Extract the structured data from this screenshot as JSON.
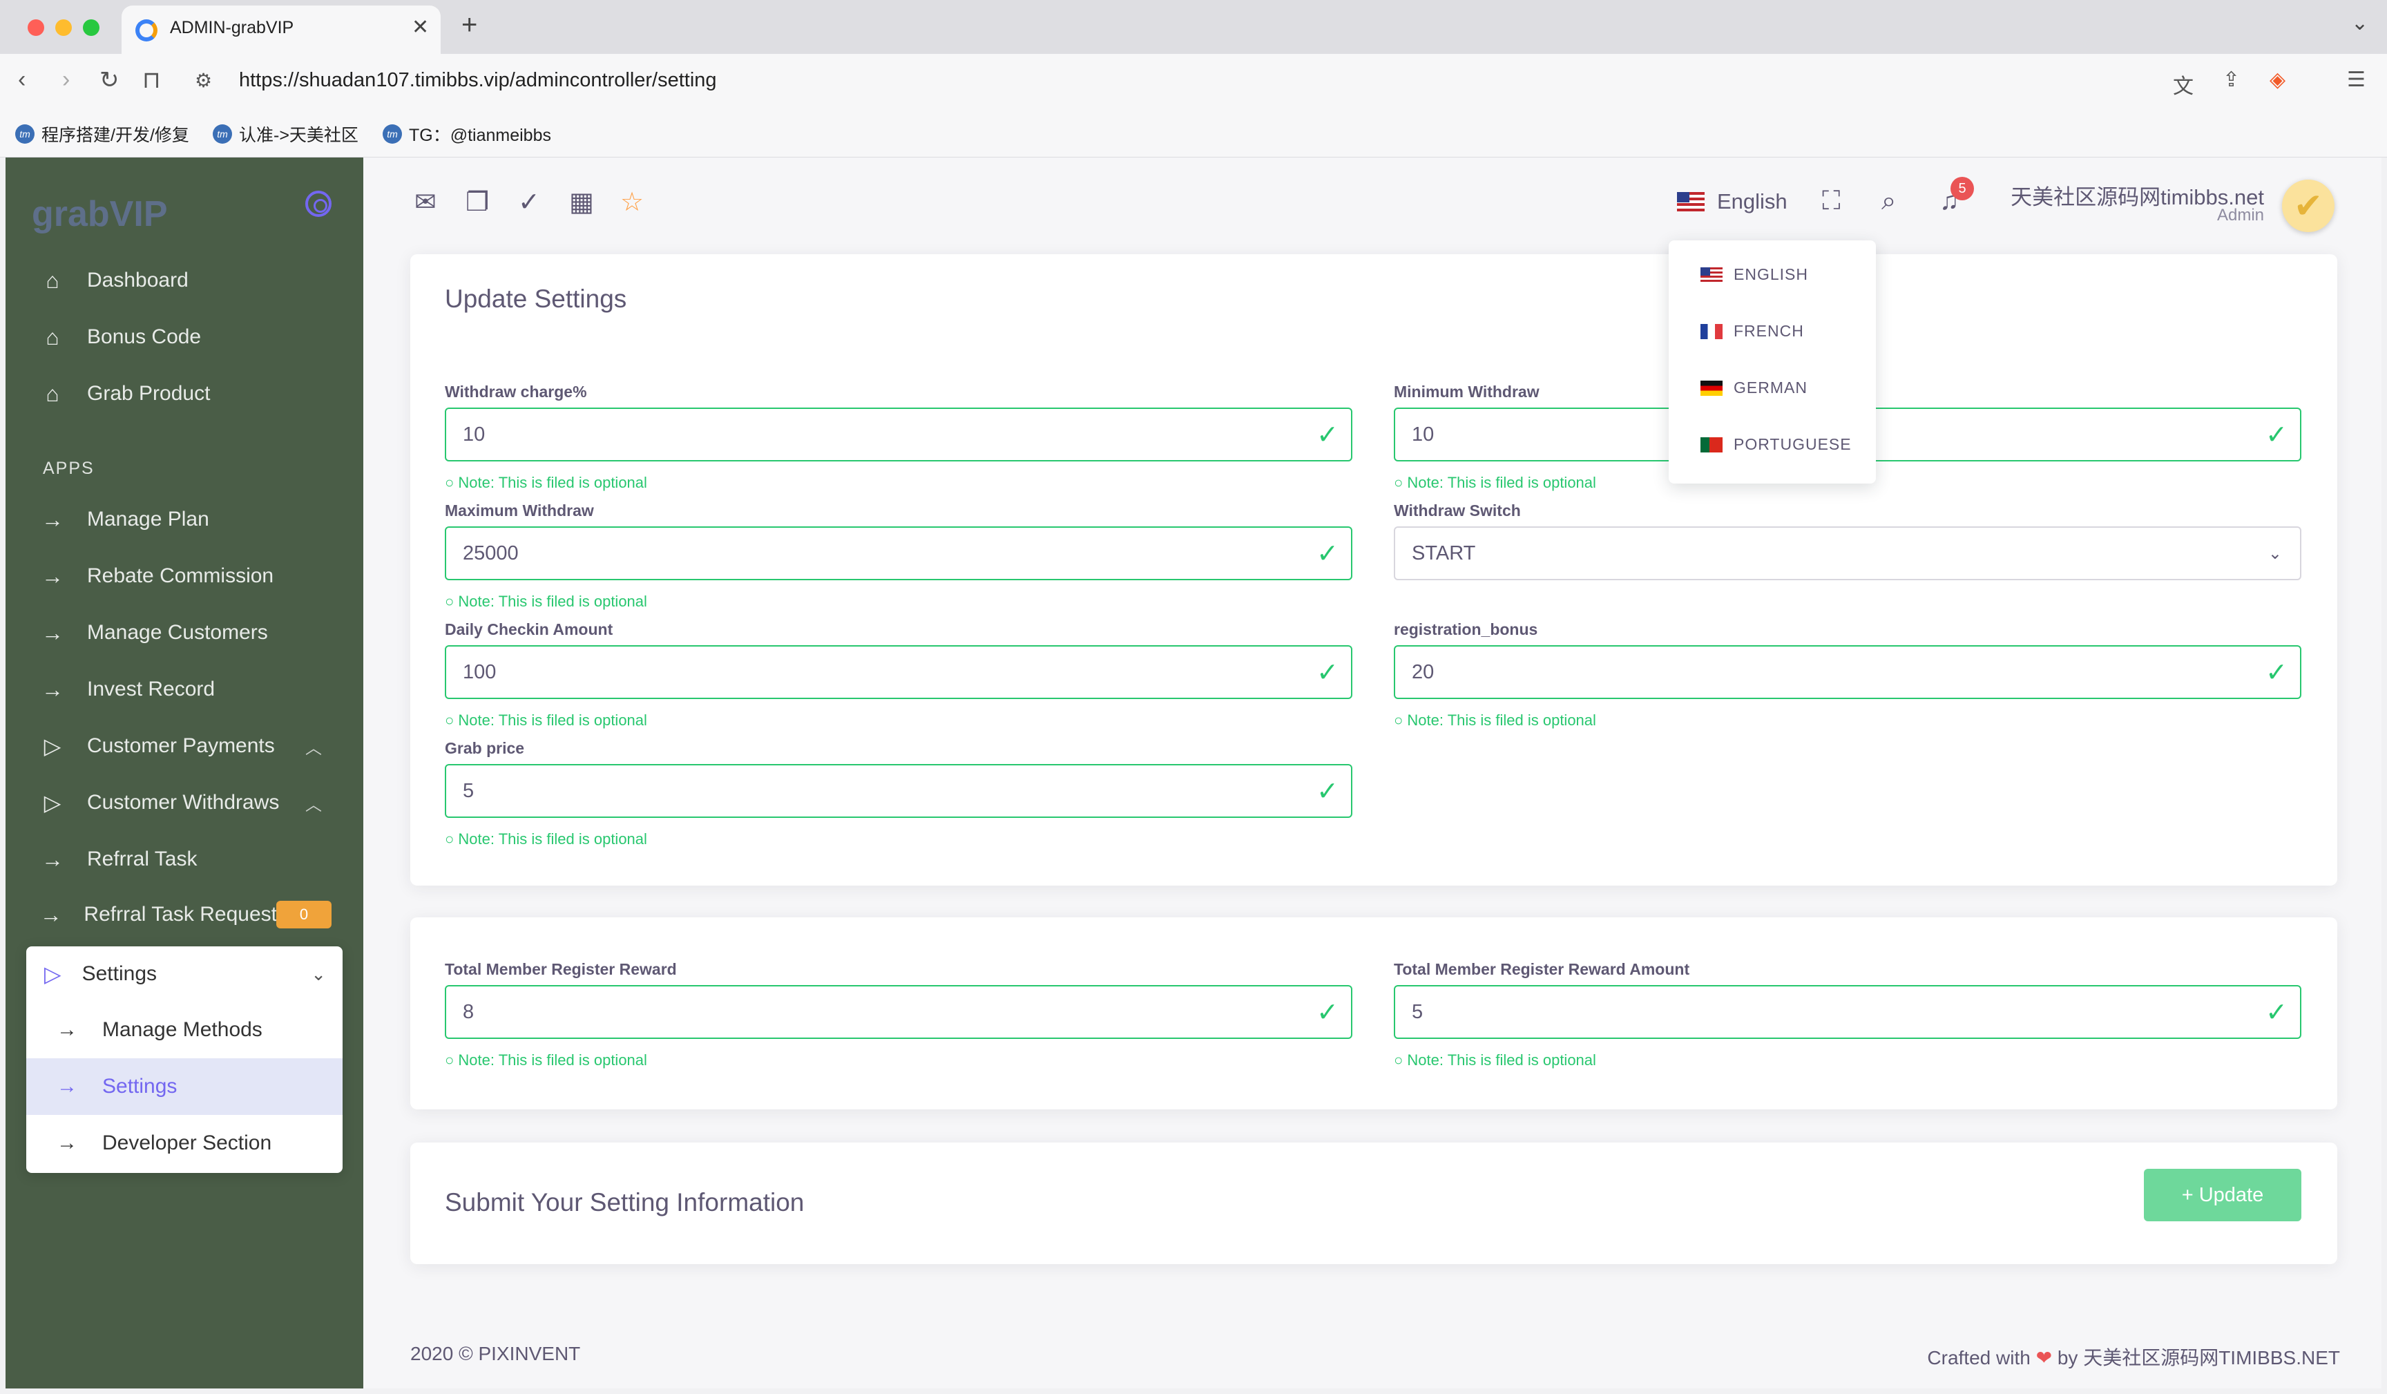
{
  "browser": {
    "tab_title": "ADMIN-grabVIP",
    "url": "https://shuadan107.timibbs.vip/admincontroller/setting",
    "bookmarks": [
      "程序搭建/开发/修复",
      "认准->天美社区",
      "TG：@tianmeibbs"
    ]
  },
  "sidebar": {
    "brand": "grabVIP",
    "top_items": [
      "Dashboard",
      "Bonus Code",
      "Grab Product"
    ],
    "apps_heading": "APPS",
    "app_items": [
      "Manage Plan",
      "Rebate Commission",
      "Manage Customers",
      "Invest Record",
      "Customer Payments",
      "Customer Withdraws",
      "Refrral Task",
      "Refrral Task Requests"
    ],
    "refrral_badge": "0",
    "settings_group": {
      "label": "Settings",
      "children": [
        "Manage Methods",
        "Settings",
        "Developer Section"
      ]
    }
  },
  "header": {
    "language": "English",
    "notifications": "5",
    "user_name": "天美社区源码网timibbs.net",
    "user_role": "Admin"
  },
  "language_menu": [
    "ENGLISH",
    "FRENCH",
    "GERMAN",
    "PORTUGUESE"
  ],
  "form": {
    "title": "Update Settings",
    "note": "Note: This is filed is optional",
    "fields": {
      "withdraw_charge": {
        "label": "Withdraw charge%",
        "value": "10"
      },
      "minimum_withdraw": {
        "label": "Minimum Withdraw",
        "value": "10"
      },
      "maximum_withdraw": {
        "label": "Maximum Withdraw",
        "value": "25000"
      },
      "withdraw_switch": {
        "label": "Withdraw Switch",
        "value": "START"
      },
      "daily_checkin": {
        "label": "Daily Checkin Amount",
        "value": "100"
      },
      "registration_bonus": {
        "label": "registration_bonus",
        "value": "20"
      },
      "grab_price": {
        "label": "Grab price",
        "value": "5"
      },
      "total_member_reward": {
        "label": "Total Member Register Reward",
        "value": "8"
      },
      "total_member_reward_amount": {
        "label": "Total Member Register Reward Amount",
        "value": "5"
      }
    }
  },
  "submit": {
    "title": "Submit Your Setting Information",
    "button": "+ Update"
  },
  "footer": {
    "left": "2020 © PIXINVENT",
    "crafted": "Crafted with",
    "by": "by 天美社区源码网TIMIBBS.NET"
  },
  "colors": {
    "success": "#28c76f",
    "primary": "#7367f0",
    "sidebar": "#4a5d47",
    "warning": "#ff9f43",
    "danger": "#ea5455"
  }
}
